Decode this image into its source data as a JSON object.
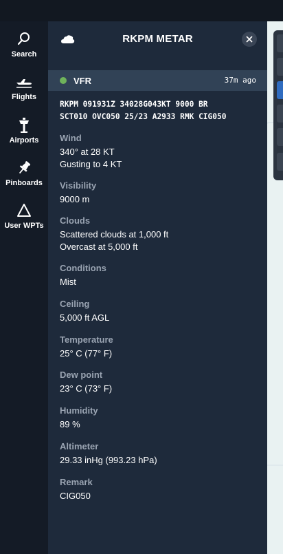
{
  "nav": {
    "items": [
      {
        "label": "Search",
        "icon": "search-icon"
      },
      {
        "label": "Flights",
        "icon": "plane-icon"
      },
      {
        "label": "Airports",
        "icon": "airport-tower-icon"
      },
      {
        "label": "Pinboards",
        "icon": "pin-icon"
      },
      {
        "label": "User WPTs",
        "icon": "triangle-icon"
      }
    ]
  },
  "panel": {
    "title": "RKPM METAR",
    "weather_icon": "cloud-icon",
    "flight_category": "VFR",
    "flight_category_color": "#6fb35b",
    "age": "37m ago",
    "raw_lines": [
      "RKPM 091931Z 34028G043KT 9000 BR",
      "SCT010 OVC050 25/23 A2933 RMK CIG050"
    ],
    "fields": {
      "wind": {
        "label": "Wind",
        "line1": "340° at 28 KT",
        "line2": "Gusting to 4 KT"
      },
      "visibility": {
        "label": "Visibility",
        "value": "9000 m"
      },
      "clouds": {
        "label": "Clouds",
        "line1": "Scattered clouds at 1,000 ft",
        "line2": "Overcast at 5,000 ft"
      },
      "conditions": {
        "label": "Conditions",
        "value": "Mist"
      },
      "ceiling": {
        "label": "Ceiling",
        "value": "5,000 ft AGL"
      },
      "temperature": {
        "label": "Temperature",
        "value": "25° C (77° F)"
      },
      "dewpoint": {
        "label": "Dew point",
        "value": "23° C (73° F)"
      },
      "humidity": {
        "label": "Humidity",
        "value": "89 %"
      },
      "altimeter": {
        "label": "Altimeter",
        "value": "29.33 inHg (993.23 hPa)"
      },
      "remark": {
        "label": "Remark",
        "value": "CIG050"
      }
    }
  }
}
